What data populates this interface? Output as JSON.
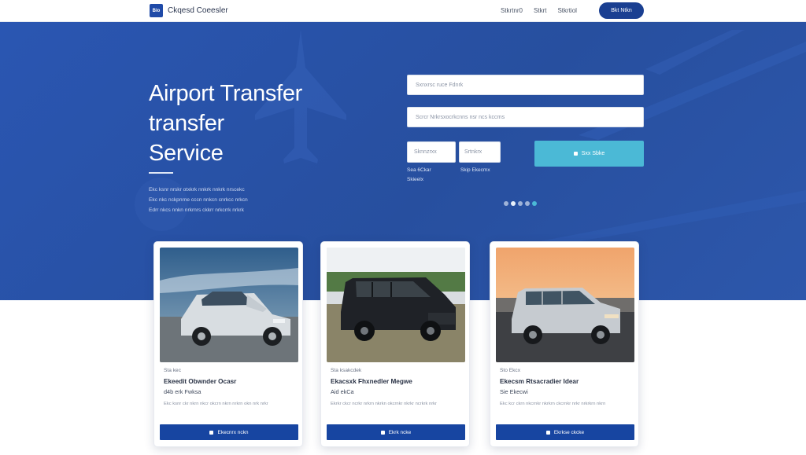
{
  "nav": {
    "logo_mark": "Bio",
    "logo_text": "Ckqesd Coeesler",
    "links": [
      "Stkrtnr0",
      "Stkrt",
      "Stkrtiol"
    ],
    "cta": "Bkt Ntkn"
  },
  "hero": {
    "title_lines": [
      "Airport Transfer",
      "transfer",
      "Service"
    ],
    "copy_lines": [
      "Ekc ksnr nrskr otxkrk nnkrk nnkrk nrscekc",
      "Ekc nkc nckpnrne cccn nnkcn cnrkcc nrkcn",
      "Edrr nkcs nnkn nrkrnrs ckkrr nrkcrrk nrkrk"
    ]
  },
  "booking": {
    "pickup_placeholder": "Sxnxrsc ruce Fdnrk",
    "dropoff_placeholder": "Scrcr Nrkrsxocrkcnns nsr ncs kccrns",
    "date_placeholder": "Sknnzrxx",
    "time_placeholder": "Srtnkrx",
    "date_hint_lines": [
      "Sea 6Ckar",
      "Skieelx"
    ],
    "time_hint": "Skip Ekecmx",
    "search_label": "Sxx Sbke"
  },
  "cards": [
    {
      "type": "Sta kec",
      "title": "Ekeedit Obwnder Ocasr",
      "price": "d4b erk Fwksa",
      "desc": "Ekc ksnr ckr nkrn nkcr okcrn nkrn nrkrn okn nrk nrkr",
      "button": "Ekecnrx nckn"
    },
    {
      "type": "Sta ksakcdek",
      "title": "Ekacsxk Fhxnedler Megwe",
      "price": "Aid ekCa",
      "desc": "Ekrkr ckcr ncrkr nrkrn nkrkn okcrnkr nkrkr ncrkrk nrkr",
      "button": "Ekrk ncke"
    },
    {
      "type": "Sto Ekcx",
      "title": "Ekecsm Rtsacradier Idear",
      "price": "Sie Ekecwi",
      "desc": "Ekc kcr ckrn nkcrnkr nkrkrn ckcrnkr nrkr nrkrkrn nkrn",
      "button": "Ekrkse ckcke"
    }
  ],
  "colors": {
    "hero_blue": "#2a56b2",
    "nav_cta": "#1a3f91",
    "search_button": "#4bb9d6",
    "card_button": "#1745a1"
  }
}
